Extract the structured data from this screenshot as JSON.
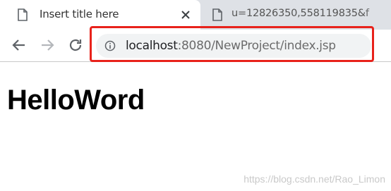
{
  "tabs": [
    {
      "title": "Insert title here",
      "close_icon": "close-icon",
      "icon": "document-icon",
      "active": true
    },
    {
      "title": "u=12826350,558119835&f",
      "icon": "document-icon",
      "active": false
    }
  ],
  "toolbar": {
    "back_icon": "arrow-left-icon",
    "forward_icon": "arrow-right-icon",
    "reload_icon": "reload-icon"
  },
  "address_bar": {
    "info_icon": "info-icon",
    "host": "localhost",
    "rest": ":8080/NewProject/index.jsp"
  },
  "page": {
    "heading": "HelloWord"
  },
  "watermark": "https://blog.csdn.net/Rao_Limon",
  "colors": {
    "highlight": "#e8221b",
    "tabstrip": "#dee1e6",
    "omnibox": "#f1f3f4"
  }
}
